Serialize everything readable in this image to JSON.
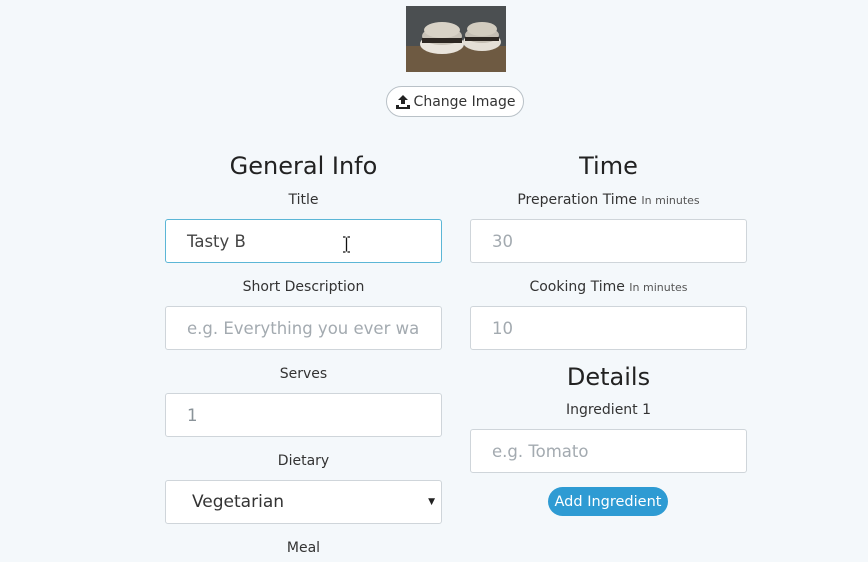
{
  "image_section": {
    "change_image_label": "Change Image"
  },
  "general_info": {
    "heading": "General Info",
    "title_label": "Title",
    "title_value": "Tasty B",
    "short_description_label": "Short Description",
    "short_description_placeholder": "e.g. Everything you ever wa",
    "serves_label": "Serves",
    "serves_value": "1",
    "dietary_label": "Dietary",
    "dietary_selected": "Vegetarian",
    "meal_label": "Meal"
  },
  "time": {
    "heading": "Time",
    "prep_label": "Preperation Time",
    "prep_hint": "In minutes",
    "prep_placeholder": "30",
    "cook_label": "Cooking Time",
    "cook_hint": "In minutes",
    "cook_placeholder": "10"
  },
  "details": {
    "heading": "Details",
    "ingredient_label": "Ingredient 1",
    "ingredient_placeholder": "e.g. Tomato",
    "add_ingredient_label": "Add Ingredient"
  },
  "colors": {
    "background": "#f4f8fb",
    "accent": "#2e9bd3",
    "focus_border": "#5bb6d6"
  },
  "icons": {
    "upload": "upload-icon",
    "select_arrow": "caret-down-icon",
    "text_cursor": "text-cursor-icon"
  }
}
